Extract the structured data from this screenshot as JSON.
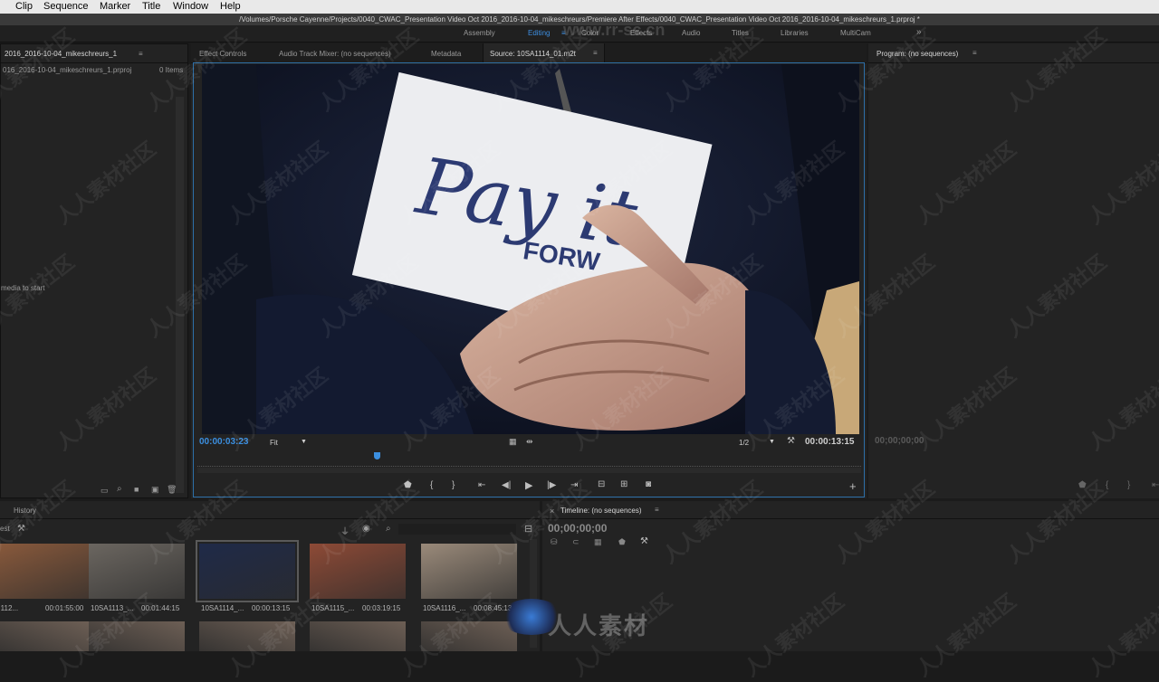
{
  "menu": [
    "Clip",
    "Sequence",
    "Marker",
    "Title",
    "Window",
    "Help"
  ],
  "title_path": "/Volumes/Porsche Cayenne/Projects/0040_CWAC_Presentation Video Oct 2016_2016-10-04_mikeschreurs/Premiere After Effects/0040_CWAC_Presentation Video Oct 2016_2016-10-04_mikeschreurs_1.prproj *",
  "workspaces": [
    "Assembly",
    "Editing",
    "Color",
    "Effects",
    "Audio",
    "Titles",
    "Libraries",
    "MultiCam"
  ],
  "workspace_active": "Editing",
  "workspace_overflow": "»",
  "workspace_menu": "≡",
  "watermark_top": "www.rr-sc.cn",
  "project": {
    "title": "2016_2016-10-04_mikeschreurs_1",
    "file": "016_2016-10-04_mikeschreurs_1.prproj",
    "items": "0 Items",
    "hint": "media to start"
  },
  "source_tabs": [
    "Effect Controls",
    "Audio Track Mixer: (no sequences)",
    "Metadata",
    "Source: 10SA1114_01.m2t"
  ],
  "panel_menu": "≡",
  "source": {
    "card_script": "Pay it",
    "card_forward": "FORW",
    "timecode_in": "00:00:03:23",
    "fit": "Fit",
    "resolution": "1/2",
    "timecode_out": "00:00:13:15",
    "playhead_fraction": 0.27
  },
  "program": {
    "title": "Program: (no sequences)",
    "timecode": "00;00;00;00"
  },
  "bin": {
    "tab": "History",
    "left_label": "est",
    "clips": [
      {
        "name": "...112...",
        "duration": "00:01:55:00",
        "color": "#8a5a3c"
      },
      {
        "name": "10SA1113_...",
        "duration": "00:01:44:15",
        "color": "#6b6660"
      },
      {
        "name": "10SA1114_...",
        "duration": "00:00:13:15",
        "color": "#1f2a48"
      },
      {
        "name": "10SA1115_...",
        "duration": "00:03:19:15",
        "color": "#8d4a36"
      },
      {
        "name": "10SA1116_...",
        "duration": "00:08:45:13",
        "color": "#9a8a7a"
      }
    ]
  },
  "timeline": {
    "title": "Timeline: (no sequences)",
    "timecode": "00;00;00;00"
  },
  "watermark_brand": "人人素材",
  "watermark_tile": "人人素材社区",
  "colors": {
    "accent": "#3b8fe0",
    "panel": "#232323",
    "bg": "#1b1b1b"
  }
}
